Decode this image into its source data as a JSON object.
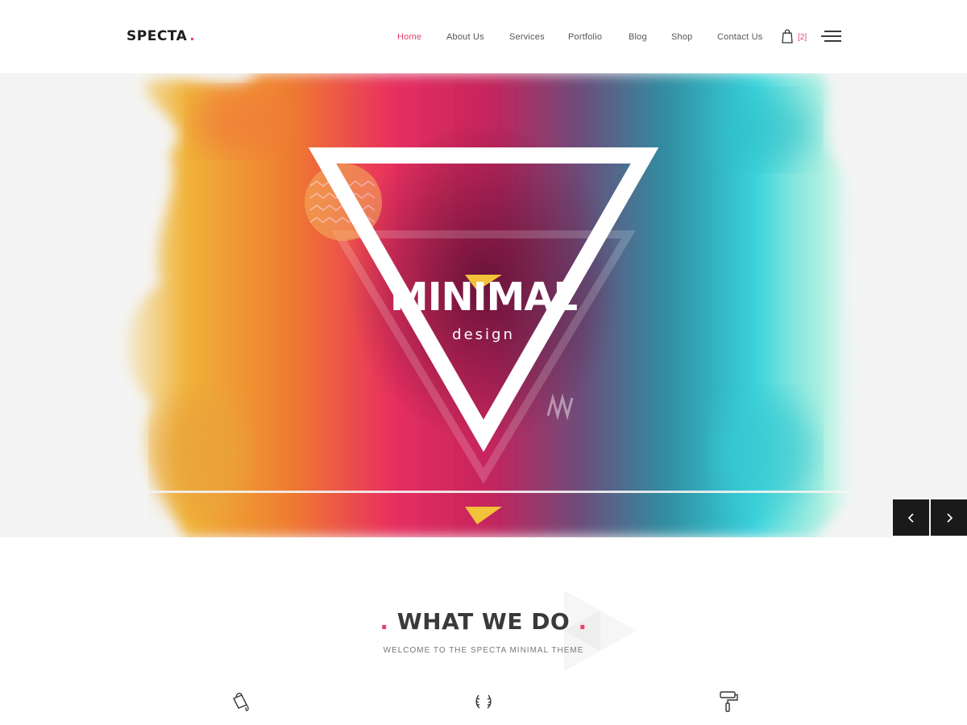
{
  "header": {
    "logo_text": "SPECTA",
    "logo_dot": ".",
    "nav": [
      {
        "label": "Home",
        "active": true
      },
      {
        "label": "About Us",
        "active": false
      },
      {
        "label": "Services",
        "active": false
      },
      {
        "label": "Portfolio",
        "active": false
      },
      {
        "label": "Blog",
        "active": false
      },
      {
        "label": "Shop",
        "active": false
      },
      {
        "label": "Contact Us",
        "active": false
      }
    ],
    "cart_icon": "shopping-bag-icon",
    "cart_count": "[2]",
    "menu_icon": "hamburger-menu-icon"
  },
  "hero": {
    "title": "MINIMAL",
    "subtitle": "design",
    "prev_icon": "chevron-left-icon",
    "next_icon": "chevron-right-icon"
  },
  "section": {
    "dot_left": ".",
    "title": "WHAT WE DO",
    "dot_right": ".",
    "subtitle": "WELCOME TO THE SPECTA MINIMAL THEME",
    "features": [
      {
        "icon": "paint-bucket-icon"
      },
      {
        "icon": "laurel-wreath-icon"
      },
      {
        "icon": "paint-roller-icon"
      }
    ]
  },
  "colors": {
    "accent": "#e8436a",
    "dark": "#1a1a1a",
    "text": "#333333"
  }
}
